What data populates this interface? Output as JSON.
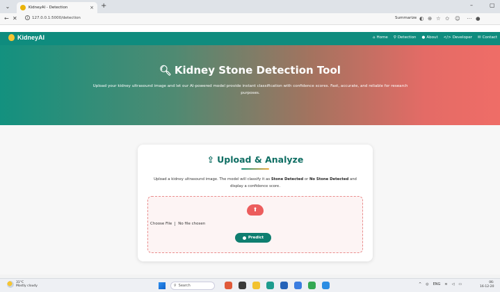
{
  "browser": {
    "tab_title": "KidneyAI - Detection",
    "tab_close": "×",
    "new_tab": "+",
    "url": "127.0.0.1:5000/detection",
    "summarize": "Summarize",
    "minimize": "–",
    "maximize": "▢"
  },
  "navbar": {
    "brand": "KidneyAI",
    "links": [
      {
        "icon": "home-icon",
        "label": "Home"
      },
      {
        "icon": "search-icon",
        "label": "Detection"
      },
      {
        "icon": "info-icon",
        "label": "About"
      },
      {
        "icon": "code-icon",
        "label": "Developer"
      },
      {
        "icon": "mail-icon",
        "label": "Contact"
      }
    ]
  },
  "hero": {
    "title": "Kidney Stone Detection Tool",
    "subtitle": "Upload your kidney ultrasound image and let our AI-powered model provide instant classification with confidence scores. Fast, accurate, and reliable for research purposes."
  },
  "card": {
    "title": "Upload & Analyze",
    "desc_prefix": "Upload a kidney ultrasound image. The model will classify it as ",
    "desc_bold1": "Stone Detected",
    "desc_mid": " or ",
    "desc_bold2": "No Stone Detected",
    "desc_suffix": " and display a confidence score.",
    "choose_file": "Choose File",
    "no_file": "No file chosen",
    "predict": "Predict"
  },
  "taskbar": {
    "temp": "31°C",
    "weather": "Mostly cloudy",
    "search": "Search",
    "lang": "ENG",
    "region": "IN",
    "time": "06:",
    "date": "16-12-20"
  },
  "colors": {
    "primary": "#0f8c7e",
    "accent": "#ec5d5d",
    "gradient_start": "#13917f",
    "gradient_end": "#ef6d67"
  }
}
